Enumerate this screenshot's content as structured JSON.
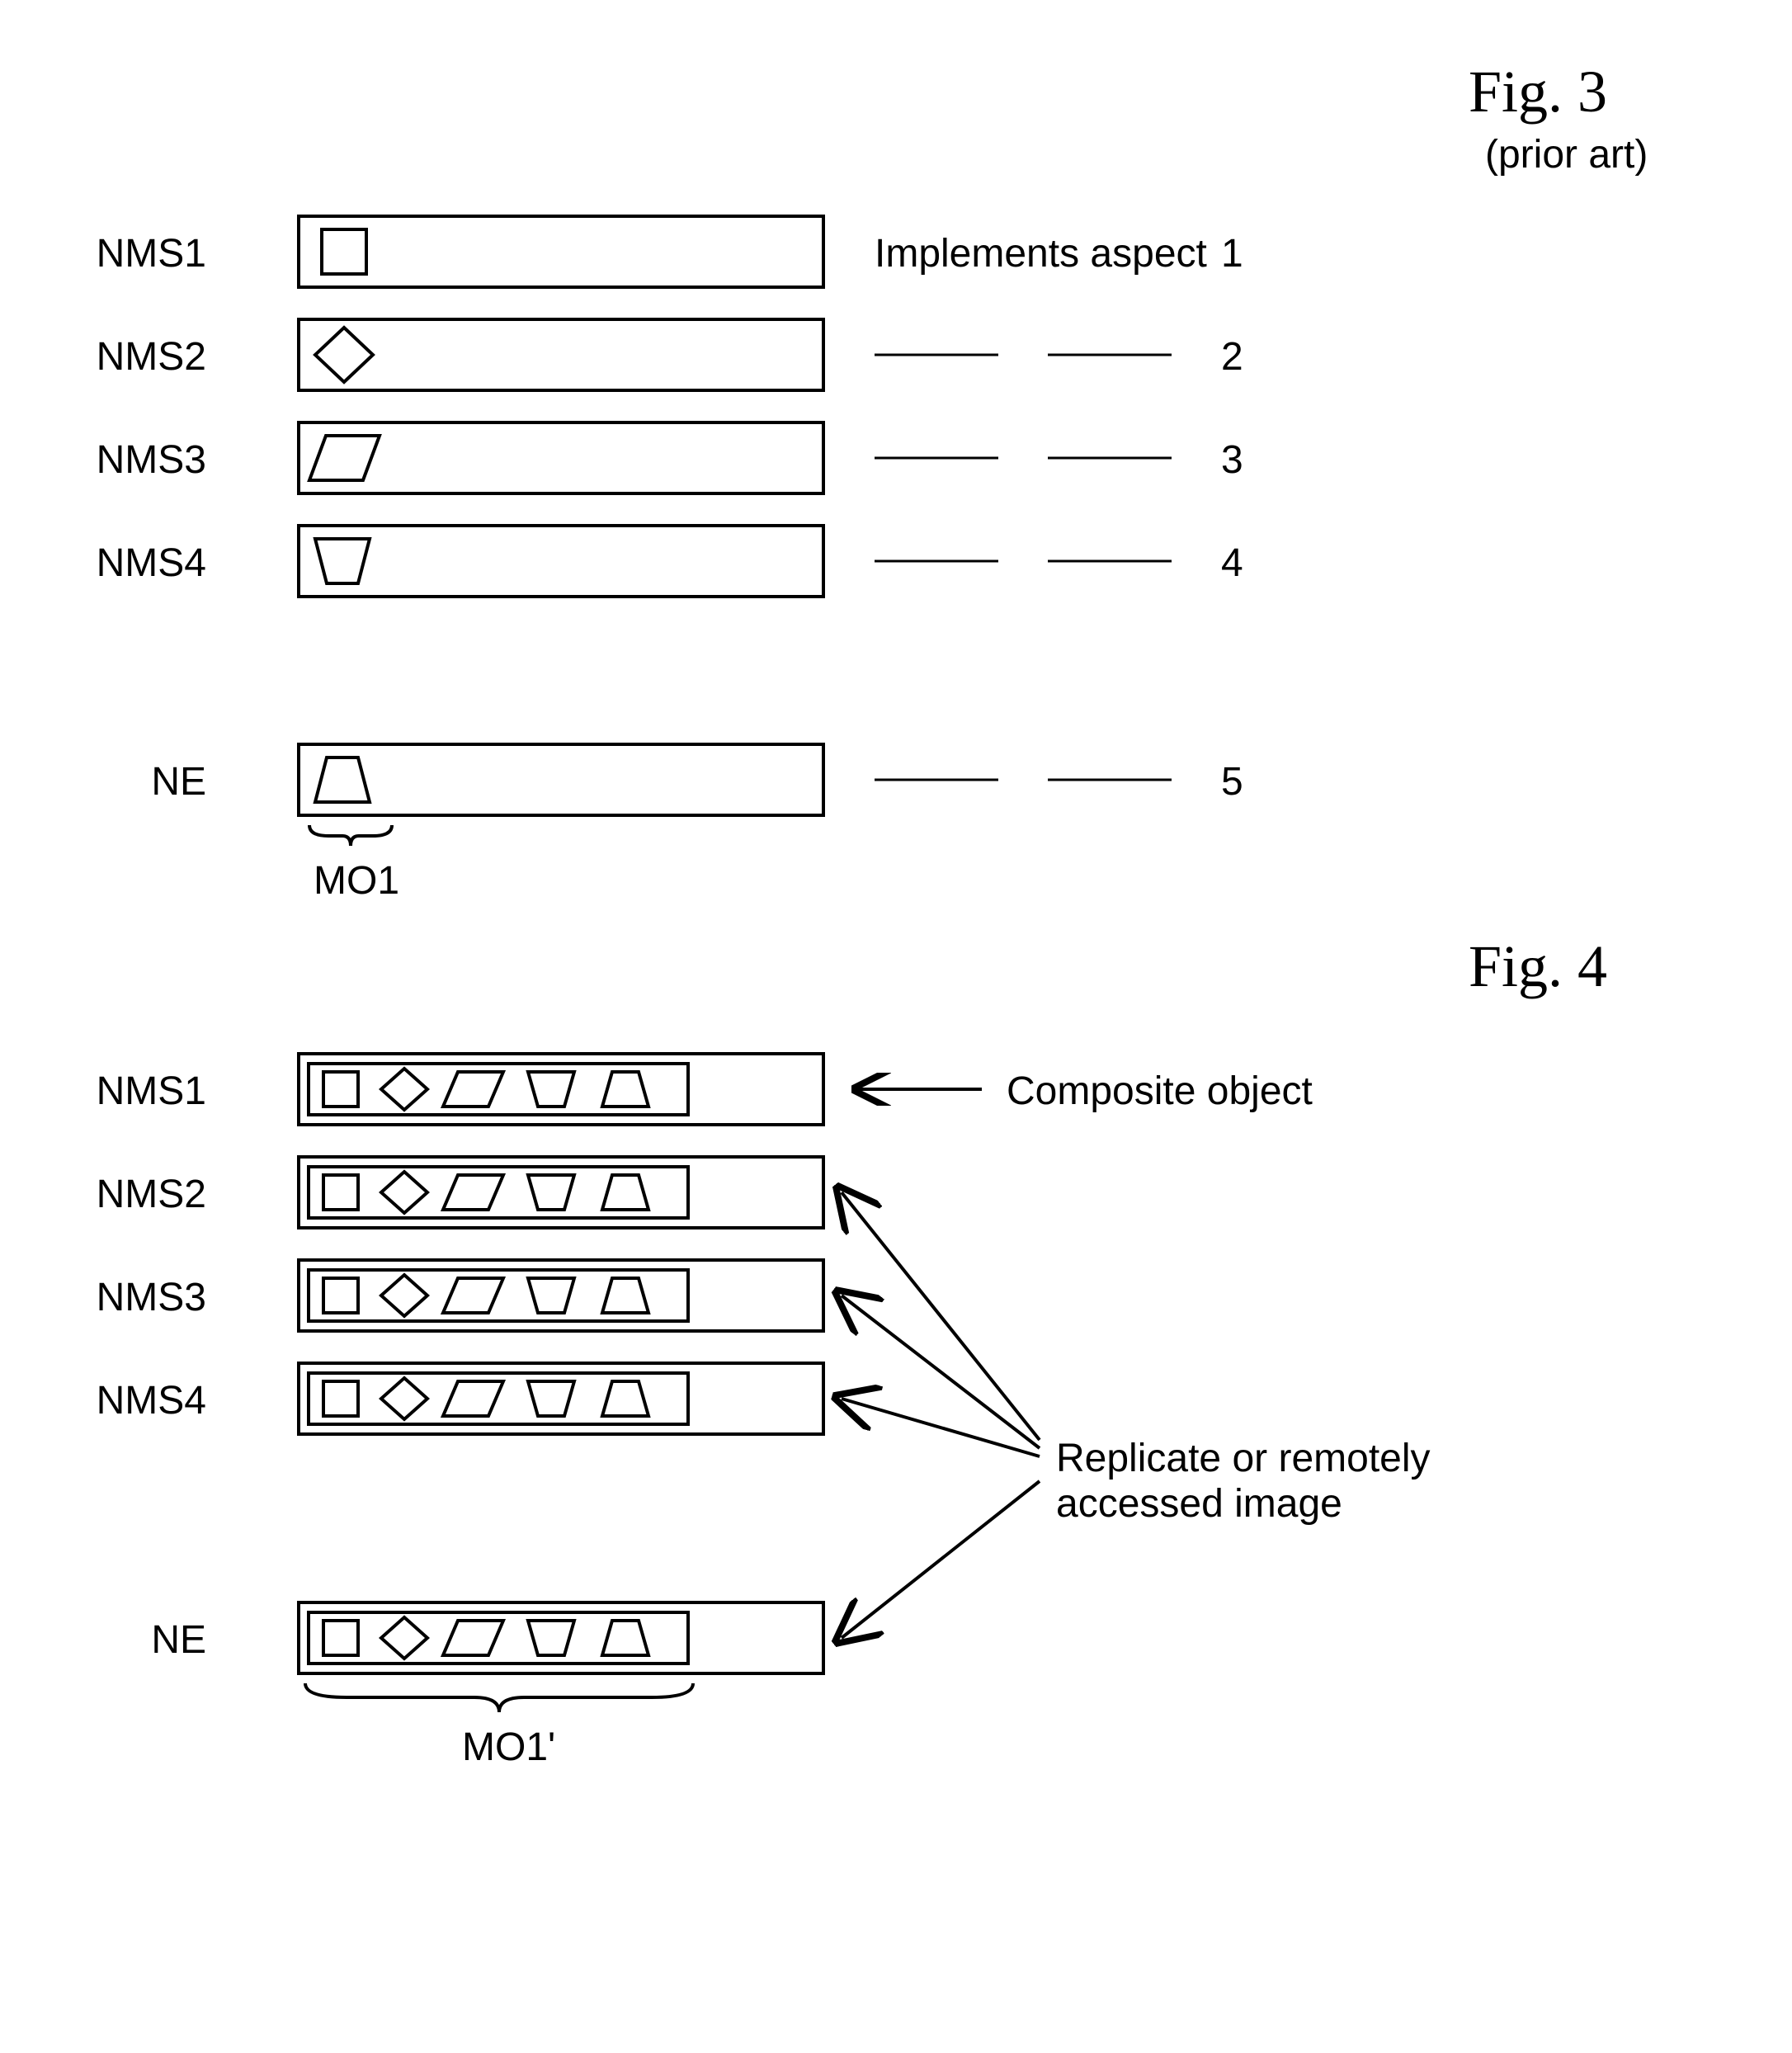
{
  "fig3": {
    "title": "Fig. 3",
    "subtitle": "(prior art)",
    "rows": [
      {
        "label": "NMS1",
        "aspect_text": "Implements aspect",
        "num": "1"
      },
      {
        "label": "NMS2",
        "aspect_text": "\"",
        "num": "2"
      },
      {
        "label": "NMS3",
        "aspect_text": "\"",
        "num": "3"
      },
      {
        "label": "NMS4",
        "aspect_text": "\"",
        "num": "4"
      },
      {
        "label": "NE",
        "aspect_text": "\"",
        "num": "5"
      }
    ],
    "mo_label": "MO1"
  },
  "fig4": {
    "title": "Fig. 4",
    "rows": [
      {
        "label": "NMS1"
      },
      {
        "label": "NMS2"
      },
      {
        "label": "NMS3"
      },
      {
        "label": "NMS4"
      },
      {
        "label": "NE"
      }
    ],
    "annotation1": "Composite object",
    "annotation2_line1": "Replicate or remotely",
    "annotation2_line2": "accessed image",
    "mo_label": "MO1'"
  }
}
